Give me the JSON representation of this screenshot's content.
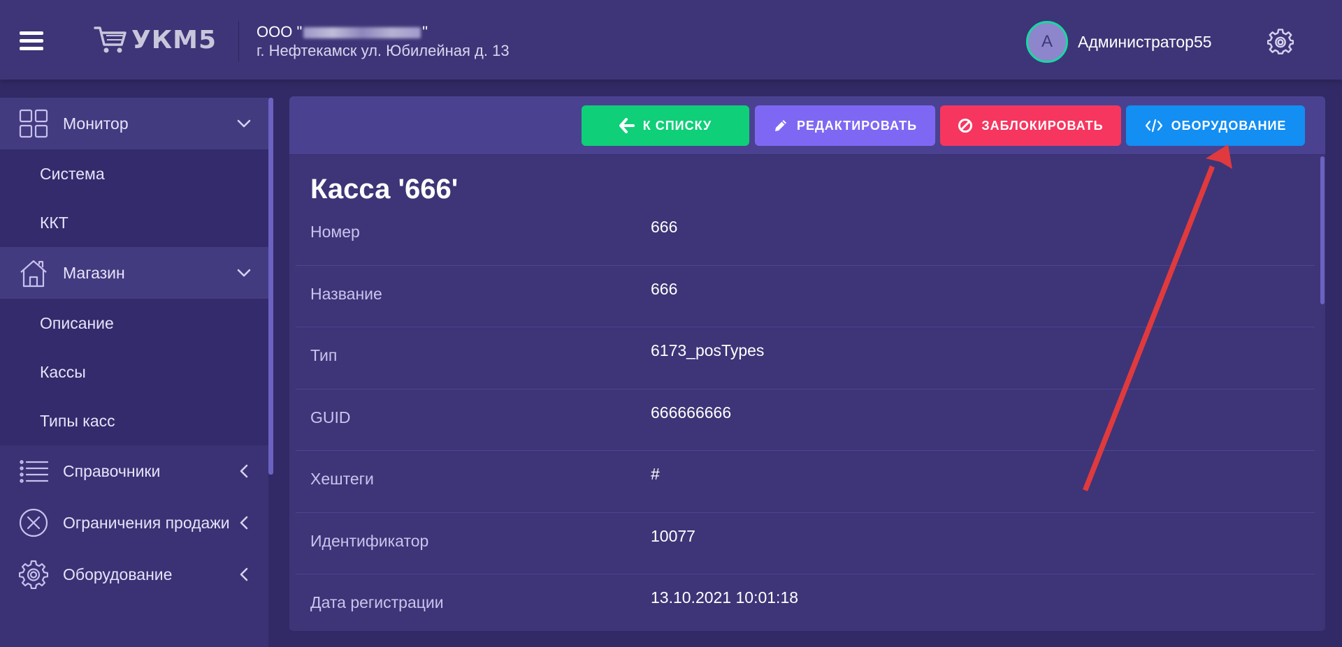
{
  "header": {
    "logo_text": "УКМ5",
    "org_prefix": "ООО \"",
    "org_suffix": "\"",
    "org_address": "г. Нефтекамск ул. Юбилейная д. 13",
    "user_initial": "А",
    "user_name": "Администратор55"
  },
  "sidebar": {
    "monitor": {
      "label": "Монитор",
      "items": [
        "Система",
        "ККТ"
      ]
    },
    "shop": {
      "label": "Магазин",
      "items": [
        "Описание",
        "Кассы",
        "Типы касс"
      ]
    },
    "references": {
      "label": "Справочники"
    },
    "restrictions": {
      "label": "Ограничения продажи"
    },
    "equipment": {
      "label": "Оборудование"
    }
  },
  "toolbar": {
    "back_label": "К СПИСКУ",
    "edit_label": "РЕДАКТИРОВАТЬ",
    "block_label": "ЗАБЛОКИРОВАТЬ",
    "hardware_label": "ОБОРУДОВАНИЕ"
  },
  "detail": {
    "title": "Касса '666'",
    "fields": [
      {
        "label": "Номер",
        "value": "666"
      },
      {
        "label": "Название",
        "value": "666"
      },
      {
        "label": "Тип",
        "value": "6173_posTypes"
      },
      {
        "label": "GUID",
        "value": "666666666"
      },
      {
        "label": "Хештеги",
        "value": "#"
      },
      {
        "label": "Идентификатор",
        "value": "10077"
      },
      {
        "label": "Дата регистрации",
        "value": "13.10.2021 10:01:18"
      }
    ]
  },
  "colors": {
    "background": "#312a66",
    "header": "#3d3577",
    "back_button": "#0fcf78",
    "edit_button": "#7e68f3",
    "block_button": "#f6365f",
    "hardware_button": "#138ef2",
    "annotation_arrow": "#e03a3e",
    "avatar_ring": "#1ad7a3"
  },
  "icons": {
    "menu": "hamburger-icon",
    "logo": "cart-icon",
    "settings": "gear-icon",
    "monitor": "grid-icon",
    "shop": "house-icon",
    "references": "list-icon",
    "restrictions": "x-circle-icon",
    "equipment": "gear-icon",
    "back": "arrow-left-icon",
    "edit": "pencil-icon",
    "block": "ban-icon",
    "hardware": "code-icon"
  }
}
